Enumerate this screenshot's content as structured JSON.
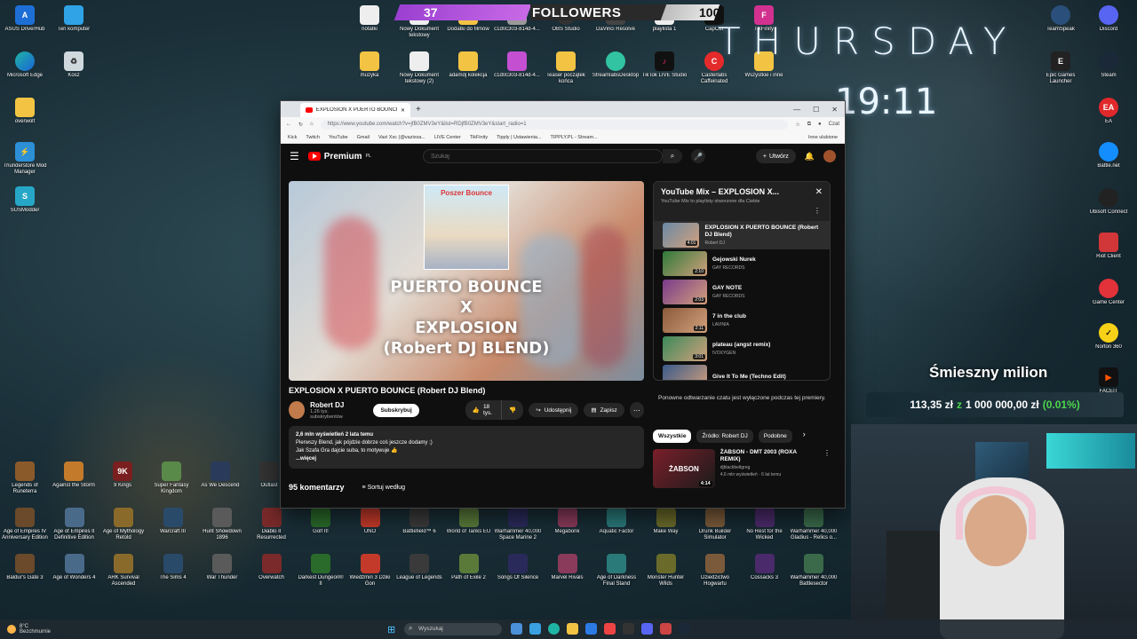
{
  "overlay": {
    "followers_left": "37",
    "followers_label": "FOLLOWERS",
    "followers_right": "100",
    "day": "THURSDAY",
    "time": "19:11"
  },
  "desktop": {
    "left_icons": [
      "ASUS DriverHub",
      "Ten komputer",
      "Microsoft Edge",
      "Kosz",
      "overwolf",
      "Thunderstore Mod Manager",
      "SUSModder"
    ],
    "top_icons": [
      "notatki",
      "Nowy Dokument tekstowy",
      "Dodatki do filmów",
      "c1d0c303-814d-4...",
      "OBS Studio",
      "DaVinci Resolve",
      "playlista 1",
      "CapCut",
      "TikFinity"
    ],
    "top_icons_row2": [
      "muzyka",
      "Nowy Dokument tekstowy (2)",
      "adamdj kolekcja",
      "c1d0c303-814d-4...",
      "Teaser początek końca",
      "StreamlabsDesktop",
      "TikTok LIVE Studio",
      "Casterlabs Caffeinated",
      "Wszystkie i inne"
    ],
    "right_icons": [
      "TeamSpeak",
      "Discord",
      "Epic Games Launcher",
      "Steam",
      "EA",
      "Battle.net",
      "Ubisoft Connect",
      "Riot Client",
      "Game Center",
      "Norton 360",
      "FACEIT"
    ],
    "game_row1": [
      "Legends of Runeterra",
      "Against the Storm",
      "9 Kings",
      "Super Fantasy Kingdom",
      "As We Descend",
      "Outlast"
    ],
    "game_row2": [
      "Age of Empires IV Anniversary Edition",
      "Age of Empires II Definitive Edition",
      "Age of Mythology Retold",
      "Warcraft III",
      "Hunt Showdown 1896",
      "Diablo II Resurrected",
      "Golf It!",
      "UNO",
      "Battlefield™ 6",
      "World of Tanks EU",
      "Warhammer 40,000 Space Marine 2",
      "Megabonk",
      "Aquatic Factor",
      "Make Way",
      "Drunk Builder Simulator",
      "No Rest for the Wicked",
      "Warhammer 40,000 Gladius - Relics o..."
    ],
    "game_row3": [
      "Baldur's Gate 3",
      "Age of Wonders 4",
      "ARK Survival Ascended",
      "The Sims 4",
      "War Thunder",
      "Overwatch",
      "Darkest Dungeon® II",
      "Wiedźmin 3 Dziki Gon",
      "League of Legends",
      "Path of Exile 2",
      "Songs Of Silence",
      "Marvel Rivals",
      "Age of Darkness Final Stand",
      "Monster Hunter Wilds",
      "Dziedzictwo Hogwartu",
      "Cossacks 3",
      "Warhammer 40,000 Battlesector"
    ]
  },
  "browser": {
    "tab_title": "EXPLOSION X PUERTO BOUNCE",
    "url": "https://www.youtube.com/watch?v=jfB0ZMV3eY&list=RDjfB0ZMV3eY&start_radio=1",
    "bookmarks": [
      "Kick",
      "Twitch",
      "YouTube",
      "Gmail",
      "Vazi Xsc (@vazixsa...",
      "LIVE Center",
      "TikFinity",
      "Tipply | Ustawienia...",
      "TIPPLY.PL - Stream..."
    ],
    "bookmarks_more": "Inne ulubione",
    "copilot": "Czat"
  },
  "youtube": {
    "logo": "Premium",
    "logo_region": "PL",
    "search_placeholder": "Szukaj",
    "create_label": "Utwórz",
    "video_thumb_title": "Poszer Bounce",
    "overlay_lines": [
      "PUERTO BOUNCE",
      "X",
      "EXPLOSION",
      "(Robert DJ BLEND)"
    ],
    "video_title": "EXPLOSION X PUERTO BOUNCE (Robert DJ Blend)",
    "channel_name": "Robert DJ",
    "channel_subs": "1,26 tys. subskrybentów",
    "subscribe_label": "Subskrybuj",
    "likes": "18 tys.",
    "share_label": "Udostępnij",
    "save_label": "Zapisz",
    "desc_meta": "2,6 mln wyświetleń  2 lata temu",
    "desc_line1": "Pierwszy Blend, jak pójdzie dobrze coś jeszcze dodamy ;)",
    "desc_line2": "Jak Szafa Gra dajcie suba, to motywuje 👍",
    "desc_more": "...więcej",
    "comments_count": "95 komentarzy",
    "sort_label": "Sortuj według",
    "playlist_title": "YouTube Mix – EXPLOSION X...",
    "playlist_sub": "YouTube Mix to playlisty stworzone dla Ciebie",
    "playlist": [
      {
        "name": "EXPLOSION X PUERTO BOUNCE (Robert DJ Blend)",
        "channel": "Robert DJ",
        "duration": "4:01"
      },
      {
        "name": "Gejowski Nurek",
        "channel": "GAY RECORDS",
        "duration": "2:10"
      },
      {
        "name": "GAY NOTE",
        "channel": "GAY RECORDS",
        "duration": "2:03"
      },
      {
        "name": "7 in the club",
        "channel": "LAVINIA",
        "duration": "2:11"
      },
      {
        "name": "plateau (angst remix)",
        "channel": "IVOXYGEN",
        "duration": "3:01"
      },
      {
        "name": "Give It To Me (Techno Edit)",
        "channel": "",
        "duration": ""
      }
    ],
    "chat_note": "Ponowne odtwarzanie czatu jest wyłączone podczas tej premiery.",
    "chips": [
      "Wszystkie",
      "Źródło: Robert DJ",
      "Podobne"
    ],
    "rec_title": "ŻABSON - DMT 2003 (ROXA REMIX)",
    "rec_channel": "djblackbeltgreg",
    "rec_meta": "4,6 mln wyświetleń · 6 lat temu",
    "rec_duration": "4:14",
    "rec_thumb_text": "ŻABSON"
  },
  "donation": {
    "title": "Śmieszny milion",
    "current": "113,35 zł",
    "z": "z",
    "goal": "1 000 000,00 zł",
    "pct": "(0.01%)"
  },
  "taskbar": {
    "weather_temp": "8°C",
    "weather_label": "Bezchmurnie",
    "search_placeholder": "Wyszukaj"
  }
}
